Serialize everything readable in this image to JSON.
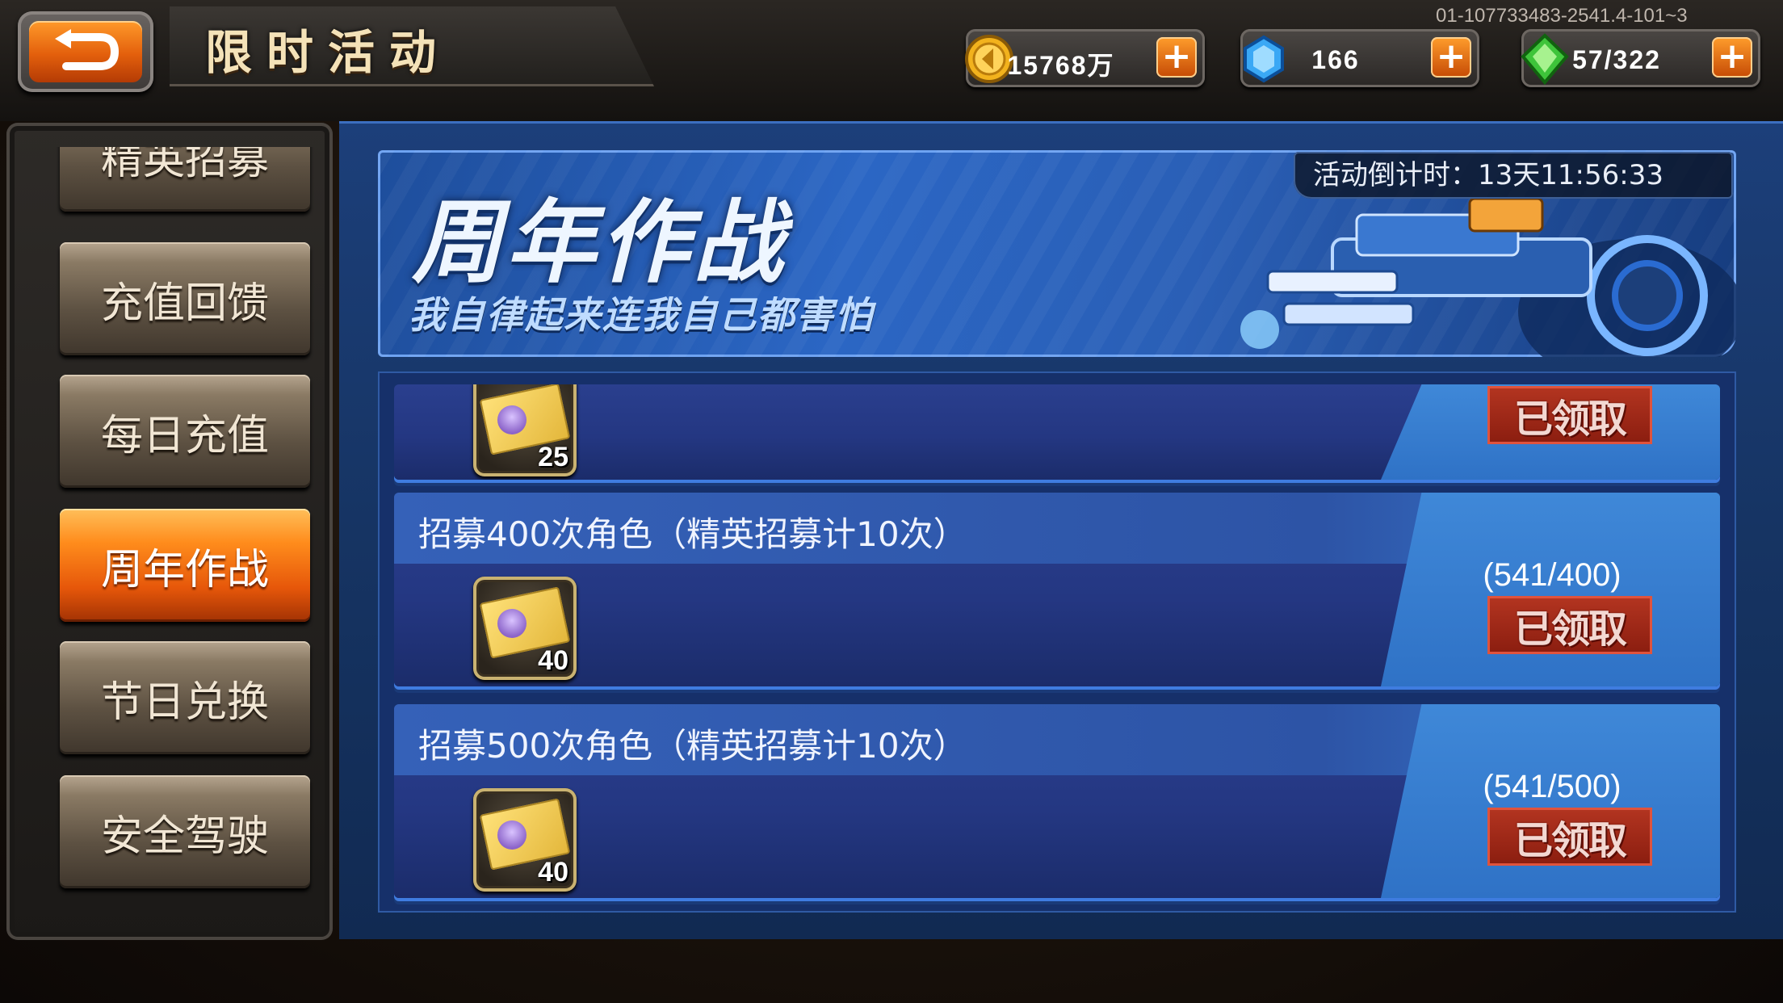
{
  "header": {
    "back_label": "",
    "title": "限时活动",
    "build_id": "01-107733483-2541.4-101~3"
  },
  "resources": [
    {
      "name": "gold",
      "icon": "gold-coin-icon",
      "value": "15768万",
      "plus": "+"
    },
    {
      "name": "gem",
      "icon": "blue-crystal-icon",
      "value": "166",
      "plus": "+"
    },
    {
      "name": "energy",
      "icon": "green-crystal-icon",
      "value": "57/322",
      "plus": "+"
    }
  ],
  "sidebar": {
    "items": [
      {
        "label": "精英招募"
      },
      {
        "label": "充值回馈"
      },
      {
        "label": "每日充值"
      },
      {
        "label": "周年作战",
        "active": true
      },
      {
        "label": "节日兑换"
      },
      {
        "label": "安全驾驶"
      }
    ]
  },
  "banner": {
    "title": "周年作战",
    "subtitle": "我自律起来连我自己都害怕",
    "countdown": "活动倒计时：13天11:56:33"
  },
  "tasks": [
    {
      "title": "",
      "reward_count": "25",
      "progress": "",
      "button": "已领取"
    },
    {
      "title": "招募400次角色（精英招募计10次）",
      "reward_count": "40",
      "progress": "(541/400)",
      "button": "已领取"
    },
    {
      "title": "招募500次角色（精英招募计10次）",
      "reward_count": "40",
      "progress": "(541/500)",
      "button": "已领取"
    }
  ],
  "colors": {
    "accent_orange": "#ff8c1c",
    "panel_blue": "#163463",
    "claimed_red": "#8c1e10"
  }
}
